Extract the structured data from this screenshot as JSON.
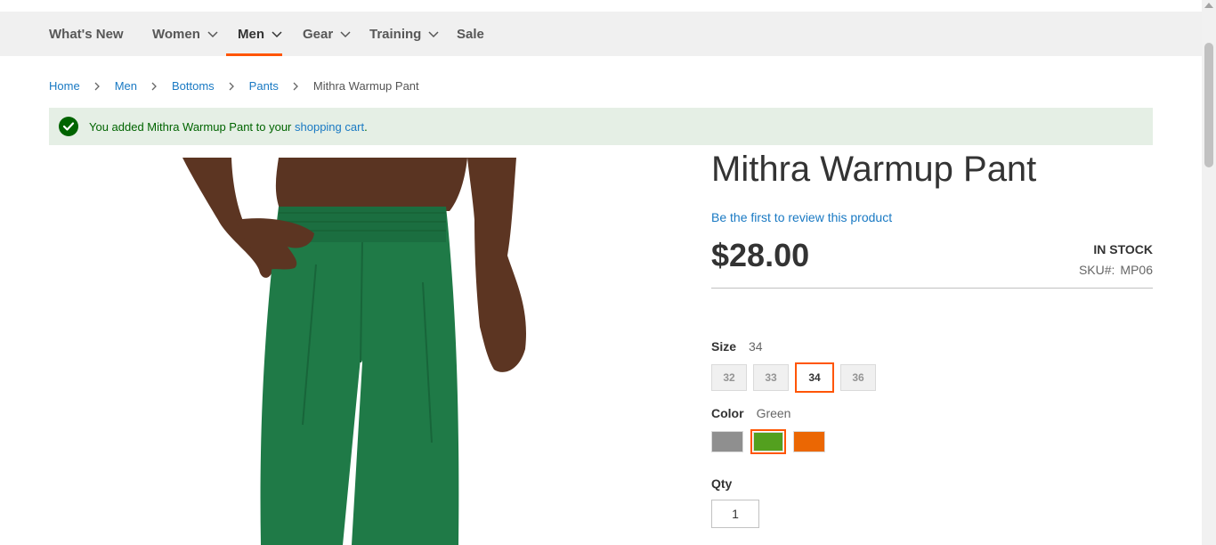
{
  "nav": {
    "items": [
      {
        "label": "What's New",
        "has_menu": false
      },
      {
        "label": "Women",
        "has_menu": true
      },
      {
        "label": "Men",
        "has_menu": true,
        "active": true
      },
      {
        "label": "Gear",
        "has_menu": true
      },
      {
        "label": "Training",
        "has_menu": true
      },
      {
        "label": "Sale",
        "has_menu": false
      }
    ],
    "accent_color": "#ff5501"
  },
  "breadcrumbs": [
    "Home",
    "Men",
    "Bottoms",
    "Pants",
    "Mithra Warmup Pant"
  ],
  "message": {
    "prefix": "You added Mithra Warmup Pant to your ",
    "link": "shopping cart",
    "suffix": ".",
    "icon": "check-circle-icon",
    "color": "#006400",
    "background": "#e5efe5"
  },
  "product": {
    "title": "Mithra Warmup Pant",
    "review_link": "Be the first to review this product",
    "price": "$28.00",
    "stock": "In stock",
    "sku_label": "SKU#:",
    "sku": "MP06",
    "image_alt": "Green warmup pants worn by a model",
    "pant_color": "#1f7a47"
  },
  "options": {
    "size": {
      "label": "Size",
      "selected": "34",
      "values": [
        "32",
        "33",
        "34",
        "36"
      ]
    },
    "color": {
      "label": "Color",
      "selected": "Green",
      "swatches": [
        {
          "name": "Gray",
          "hex": "#8f8f8f"
        },
        {
          "name": "Green",
          "hex": "#53a01f"
        },
        {
          "name": "Orange",
          "hex": "#eb6703"
        }
      ]
    }
  },
  "qty": {
    "label": "Qty",
    "value": "1"
  }
}
